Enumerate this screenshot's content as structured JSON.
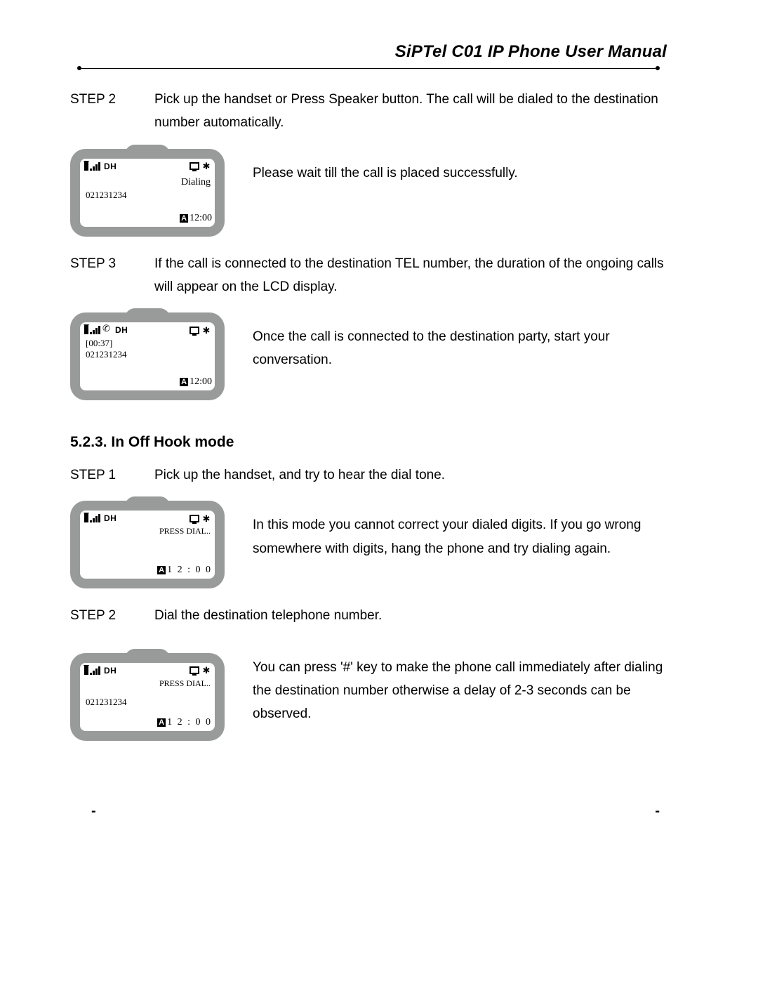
{
  "header": {
    "title": "SiPTel C01 IP Phone User Manual"
  },
  "section_a": {
    "step2_label": "STEP 2",
    "step2_text": "Pick up the handset or Press Speaker button. The call will be dialed to the destination number automatically.",
    "lcd1": {
      "dh": "DH",
      "status_right": "Dialing",
      "number": "021231234",
      "clock_tag": "A",
      "clock": "12:00"
    },
    "desc1": "Please wait till the call is placed successfully.",
    "step3_label": "STEP 3",
    "step3_text": "If the call is connected to the destination TEL number, the duration of the ongoing calls will appear on the LCD display.",
    "lcd2": {
      "dh": "DH",
      "duration": "[00:37]",
      "number": "021231234",
      "clock_tag": "A",
      "clock": "12:00"
    },
    "desc2": "Once the call is connected to the destination party, start your conversation."
  },
  "section_b": {
    "heading": "5.2.3.  In Off Hook mode",
    "step1_label": "STEP 1",
    "step1_text": "Pick up the handset, and try to hear the dial tone.",
    "lcd3": {
      "dh": "DH",
      "prompt": "PRESS DIAL..",
      "clock_tag": "A",
      "clock": "1 2 : 0 0"
    },
    "desc3": "In this mode you cannot correct your dialed digits. If you go wrong somewhere with digits, hang the phone and try dialing again.",
    "step2_label": "STEP 2",
    "step2_text": "Dial the destination telephone number.",
    "lcd4": {
      "dh": "DH",
      "prompt": "PRESS DIAL..",
      "number": "021231234",
      "clock_tag": "A",
      "clock": "1 2 : 0 0"
    },
    "desc4": "You can press '#' key to make the phone call immediately after dialing the destination number otherwise a delay of 2-3 seconds can be observed."
  },
  "footer": {
    "dash_left": "-",
    "dash_right": "-"
  }
}
